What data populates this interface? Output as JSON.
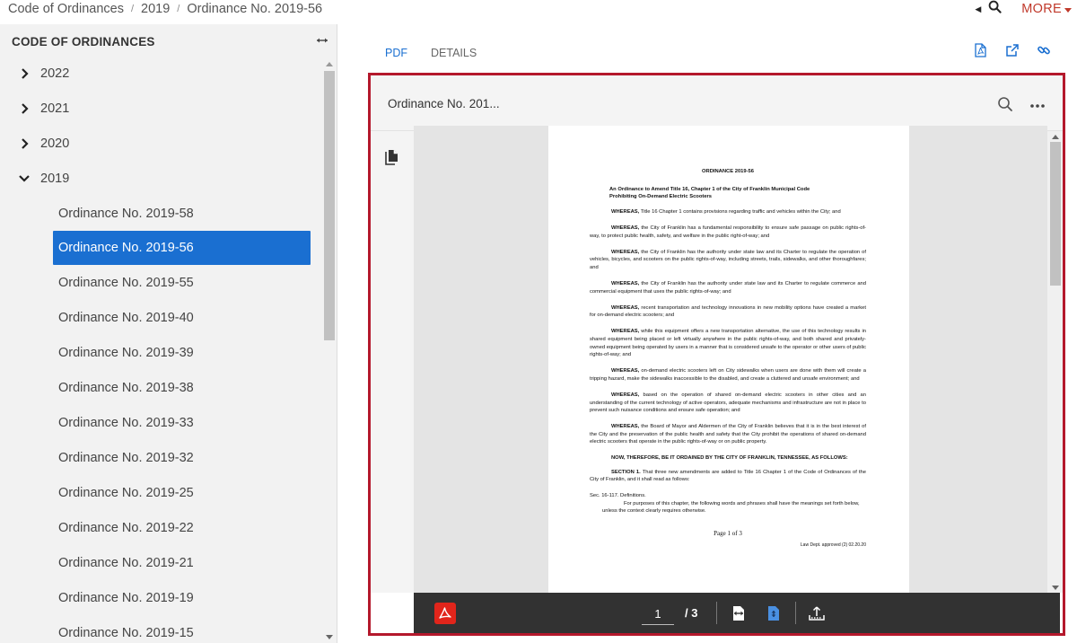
{
  "breadcrumb": {
    "items": [
      "Code of Ordinances",
      "2019",
      "Ordinance No. 2019-56"
    ]
  },
  "header": {
    "more_label": "MORE"
  },
  "sidebar": {
    "title": "CODE OF ORDINANCES",
    "years": [
      {
        "label": "2022",
        "expanded": false
      },
      {
        "label": "2021",
        "expanded": false
      },
      {
        "label": "2020",
        "expanded": false
      },
      {
        "label": "2019",
        "expanded": true
      }
    ],
    "items": [
      "Ordinance No. 2019-58",
      "Ordinance No. 2019-56",
      "Ordinance No. 2019-55",
      "Ordinance No. 2019-40",
      "Ordinance No. 2019-39",
      "Ordinance No. 2019-38",
      "Ordinance No. 2019-33",
      "Ordinance No. 2019-32",
      "Ordinance No. 2019-25",
      "Ordinance No. 2019-22",
      "Ordinance No. 2019-21",
      "Ordinance No. 2019-19",
      "Ordinance No. 2019-15"
    ],
    "active_item": "Ordinance No. 2019-56"
  },
  "tabs": [
    {
      "label": "PDF",
      "active": true
    },
    {
      "label": "DETAILS",
      "active": false
    }
  ],
  "viewer": {
    "title": "Ordinance No. 201...",
    "page_current": "1",
    "page_total": "/ 3"
  },
  "document": {
    "heading": "ORDINANCE 2019-56",
    "subheading_line1": "An Ordinance to Amend Title 16, Chapter 1 of the City of Franklin Municipal Code",
    "subheading_line2": "Prohibiting On-Demand Electric Scooters",
    "paragraphs": [
      {
        "lead": "WHEREAS,",
        "text": " Title 16 Chapter 1 contains provisions regarding traffic and vehicles within the City; and"
      },
      {
        "lead": "WHEREAS,",
        "text": " the City of Franklin has a fundamental responsibility to ensure safe passage on public rights-of-way, to protect public health, safety, and welfare in the public right-of-way; and"
      },
      {
        "lead": "WHEREAS,",
        "text": " the City of Franklin has the authority under state law and its Charter to regulate the operation of vehicles, bicycles, and scooters on the public rights-of-way, including streets, trails, sidewalks, and other thoroughfares; and"
      },
      {
        "lead": "WHEREAS,",
        "text": " the City of Franklin has the authority under state law and its Charter to regulate commerce and commercial equipment that uses the public rights-of-way; and"
      },
      {
        "lead": "WHEREAS,",
        "text": " recent transportation and technology innovations in new mobility options have created a market for on-demand electric scooters; and"
      },
      {
        "lead": "WHEREAS,",
        "text": " while this equipment offers a new transportation alternative, the use of this technology results in shared equipment being placed or left virtually anywhere in the public rights-of-way, and both shared and privately-owned equipment being operated by users in a manner that is considered unsafe to the operator or other users of public rights-of-way; and"
      },
      {
        "lead": "WHEREAS,",
        "text": " on-demand electric scooters left on City sidewalks when users are done with them will create a tripping hazard, make the sidewalks inaccessible to the disabled, and create a cluttered and unsafe environment; and"
      },
      {
        "lead": "WHEREAS,",
        "text": " based on the operation of shared on-demand electric scooters in other cities and an understanding of the current technology of active operators, adequate mechanisms and infrastructure are not in place to prevent such nuisance conditions and ensure safe operation; and"
      },
      {
        "lead": "WHEREAS,",
        "text": " the Board of Mayor and Aldermen of the City of Franklin believes that it is in the best interest of the City and the preservation of the public health and safety that the City prohibit the operations of shared on-demand electric scooters that operate in the public rights-of-way or on public property."
      }
    ],
    "now_therefore": "NOW, THEREFORE, BE IT ORDAINED BY THE CITY OF FRANKLIN, TENNESSEE, AS FOLLOWS:",
    "section1_lead": "SECTION 1.",
    "section1_text": " That three new amendments are added to Title 16 Chapter 1 of the Code of Ordinances of the City of Franklin, and it shall read as follows:",
    "sec_def": "Sec. 16-117. Definitions.",
    "sec_def_body": "For purposes of this chapter, the following words and phrases shall have the meanings set forth below, unless the context clearly requires otherwise.",
    "page_label": "Page 1 of 3",
    "law_dept": "Law Dept. approved (2) 02.20.20"
  }
}
